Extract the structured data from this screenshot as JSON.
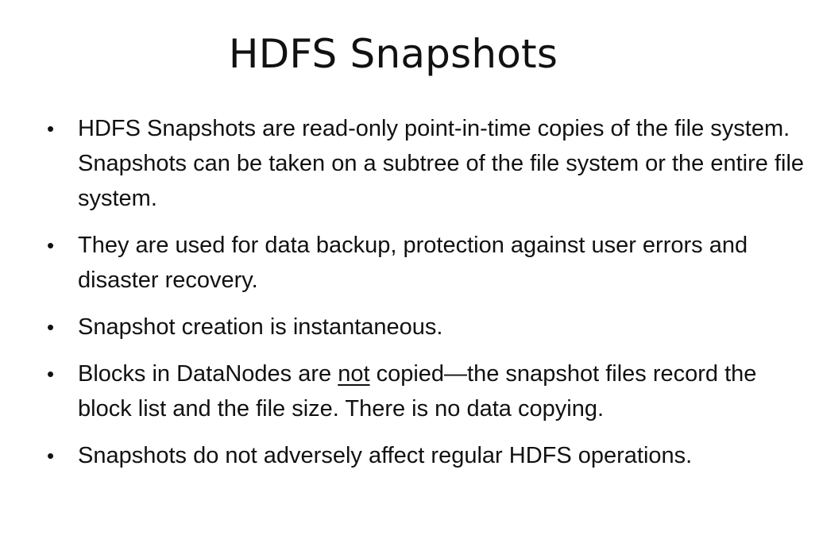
{
  "title": "HDFS Snapshots",
  "bullets": [
    {
      "text": "HDFS Snapshots are read-only point-in-time copies of the file system. Snapshots can be taken on a subtree of the file system or the entire file system."
    },
    {
      "text": "They are used for data backup, protection against user errors and disaster recovery."
    },
    {
      "text": "Snapshot creation is instantaneous."
    },
    {
      "pre": "Blocks in DataNodes are ",
      "underlined": "not",
      "post": " copied—the snapshot files record the block list and the file size. There is no data copying."
    },
    {
      "text": "Snapshots do not adversely affect regular HDFS operations."
    }
  ],
  "bullet_glyph": "•"
}
